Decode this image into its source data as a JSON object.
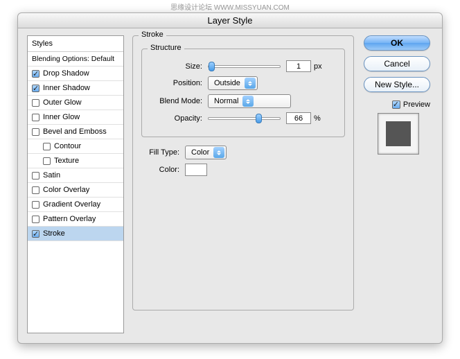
{
  "watermark": "思缘设计论坛 WWW.MISSYUAN.COM",
  "title": "Layer Style",
  "styles": {
    "header": "Styles",
    "blending": "Blending Options: Default",
    "items": [
      {
        "label": "Drop Shadow",
        "checked": true,
        "selected": false
      },
      {
        "label": "Inner Shadow",
        "checked": true,
        "selected": false
      },
      {
        "label": "Outer Glow",
        "checked": false,
        "selected": false
      },
      {
        "label": "Inner Glow",
        "checked": false,
        "selected": false
      },
      {
        "label": "Bevel and Emboss",
        "checked": false,
        "selected": false
      },
      {
        "label": "Contour",
        "checked": false,
        "selected": false,
        "indent": true
      },
      {
        "label": "Texture",
        "checked": false,
        "selected": false,
        "indent": true
      },
      {
        "label": "Satin",
        "checked": false,
        "selected": false
      },
      {
        "label": "Color Overlay",
        "checked": false,
        "selected": false
      },
      {
        "label": "Gradient Overlay",
        "checked": false,
        "selected": false
      },
      {
        "label": "Pattern Overlay",
        "checked": false,
        "selected": false
      },
      {
        "label": "Stroke",
        "checked": true,
        "selected": true
      }
    ]
  },
  "main": {
    "title": "Stroke",
    "structure_title": "Structure",
    "size_label": "Size:",
    "size_value": "1",
    "size_unit": "px",
    "position_label": "Position:",
    "position_value": "Outside",
    "blendmode_label": "Blend Mode:",
    "blendmode_value": "Normal",
    "opacity_label": "Opacity:",
    "opacity_value": "66",
    "opacity_unit": "%",
    "filltype_label": "Fill Type:",
    "filltype_value": "Color",
    "color_label": "Color:",
    "color_value": "#ffffff"
  },
  "buttons": {
    "ok": "OK",
    "cancel": "Cancel",
    "new_style": "New Style...",
    "preview": "Preview",
    "preview_checked": true,
    "preview_color": "#555555"
  }
}
